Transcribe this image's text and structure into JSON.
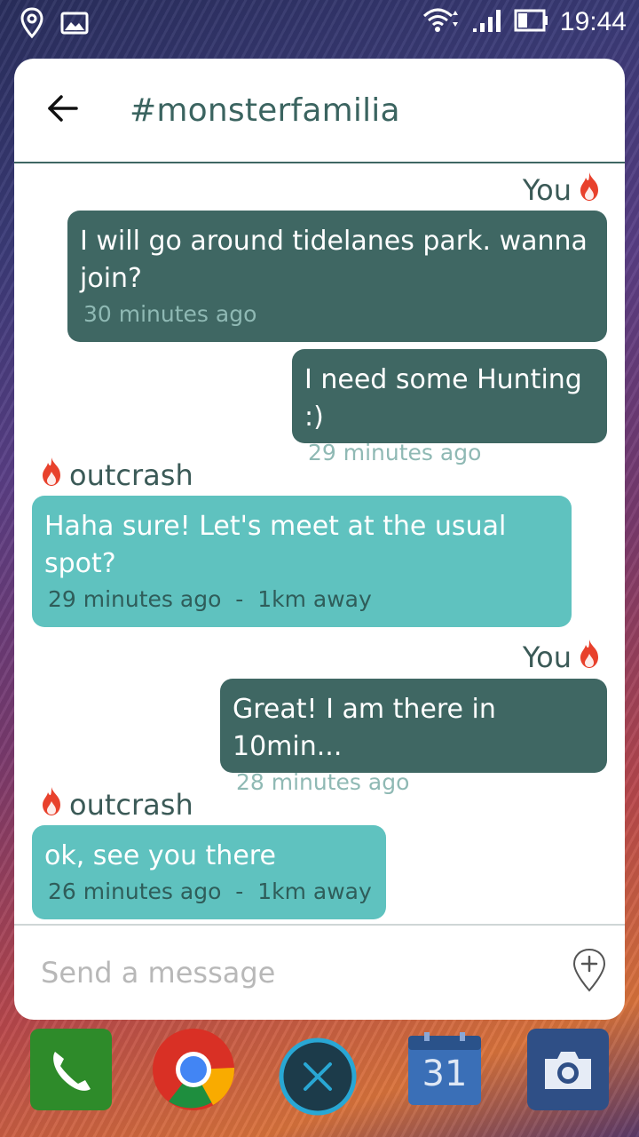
{
  "status_bar": {
    "time": "19:44",
    "icons": [
      "location-icon",
      "gallery-icon",
      "wifi-icon",
      "signal-icon",
      "battery-icon"
    ]
  },
  "chat": {
    "title": "#monsterfamilia",
    "back_icon": "arrow-left-icon",
    "messages": [
      {
        "sender": "You",
        "mine": true,
        "show_sender": true,
        "text_lines": [
          "I will go around tidelanes park. wanna",
          "join?"
        ],
        "meta": "30 minutes ago"
      },
      {
        "sender": "You",
        "mine": true,
        "show_sender": false,
        "text_lines": [
          "I need some Hunting :)"
        ],
        "meta": "29 minutes ago"
      },
      {
        "sender": "outcrash",
        "mine": false,
        "show_sender": true,
        "text_lines": [
          "Haha sure! Let's meet at the usual",
          "spot?"
        ],
        "meta": "29 minutes ago  -  1km away"
      },
      {
        "sender": "You",
        "mine": true,
        "show_sender": true,
        "text_lines": [
          "Great! I am there in 10min..."
        ],
        "meta": "28 minutes ago"
      },
      {
        "sender": "outcrash",
        "mine": false,
        "show_sender": true,
        "text_lines": [
          "ok, see you there"
        ],
        "meta": "26 minutes ago  -  1km away"
      }
    ],
    "composer": {
      "placeholder": "Send a message",
      "location_icon": "add-location-icon"
    }
  },
  "dock": {
    "apps": [
      "phone",
      "chrome",
      "close",
      "calendar",
      "camera"
    ],
    "calendar_date": "31"
  },
  "colors": {
    "my_bubble": "#3f6763",
    "their_bubble": "#5fc2bf",
    "flame": "#e8412c"
  }
}
